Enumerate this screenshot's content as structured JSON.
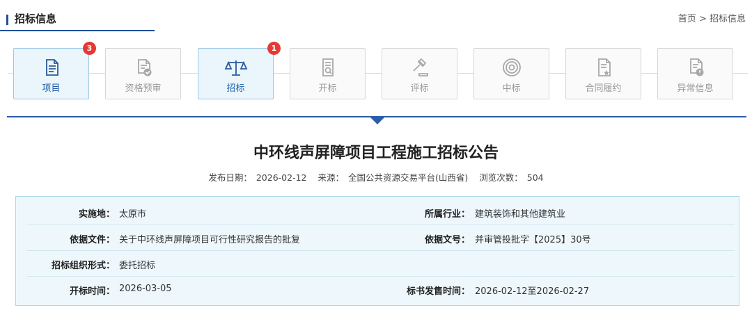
{
  "header": {
    "title": "招标信息",
    "breadcrumb": [
      "首页",
      ">",
      "招标信息"
    ]
  },
  "steps": [
    {
      "label": "项目",
      "icon": "document-icon",
      "active": true,
      "badge": "3"
    },
    {
      "label": "资格预审",
      "icon": "certified-document-icon",
      "active": false,
      "badge": ""
    },
    {
      "label": "招标",
      "icon": "scales-icon",
      "active": true,
      "badge": "1"
    },
    {
      "label": "开标",
      "icon": "open-document-icon",
      "active": false,
      "badge": ""
    },
    {
      "label": "评标",
      "icon": "gavel-icon",
      "active": false,
      "badge": ""
    },
    {
      "label": "中标",
      "icon": "target-icon",
      "active": false,
      "badge": ""
    },
    {
      "label": "合同履约",
      "icon": "contract-icon",
      "active": false,
      "badge": ""
    },
    {
      "label": "异常信息",
      "icon": "alert-document-icon",
      "active": false,
      "badge": ""
    }
  ],
  "article": {
    "title": "中环线声屏障项目工程施工招标公告",
    "publish_label": "发布日期：",
    "publish_date": "2026-02-12",
    "source_label": "来源：",
    "source": "全国公共资源交易平台(山西省)",
    "views_label": "浏览次数：",
    "views": "504"
  },
  "info": {
    "rows": [
      {
        "k1": "实施地：",
        "v1": "太原市",
        "k2": "所属行业：",
        "v2": "建筑装饰和其他建筑业"
      },
      {
        "k1": "依据文件：",
        "v1": "关于中环线声屏障项目可行性研究报告的批复",
        "k2": "依据文号：",
        "v2": "并审管投批字【2025】30号"
      },
      {
        "k1": "招标组织形式：",
        "v1": "委托招标",
        "k2": "",
        "v2": ""
      },
      {
        "k1": "开标时间：",
        "v1": "2026-03-05",
        "k2": "标书发售时间：",
        "v2": "2026-02-12至2026-02-27"
      }
    ]
  },
  "colors": {
    "accent": "#1f4e98",
    "active_border": "#9bc7e6",
    "active_bg": "#eaf5fc",
    "badge": "#e53935",
    "table_bg": "#eef8fc"
  }
}
